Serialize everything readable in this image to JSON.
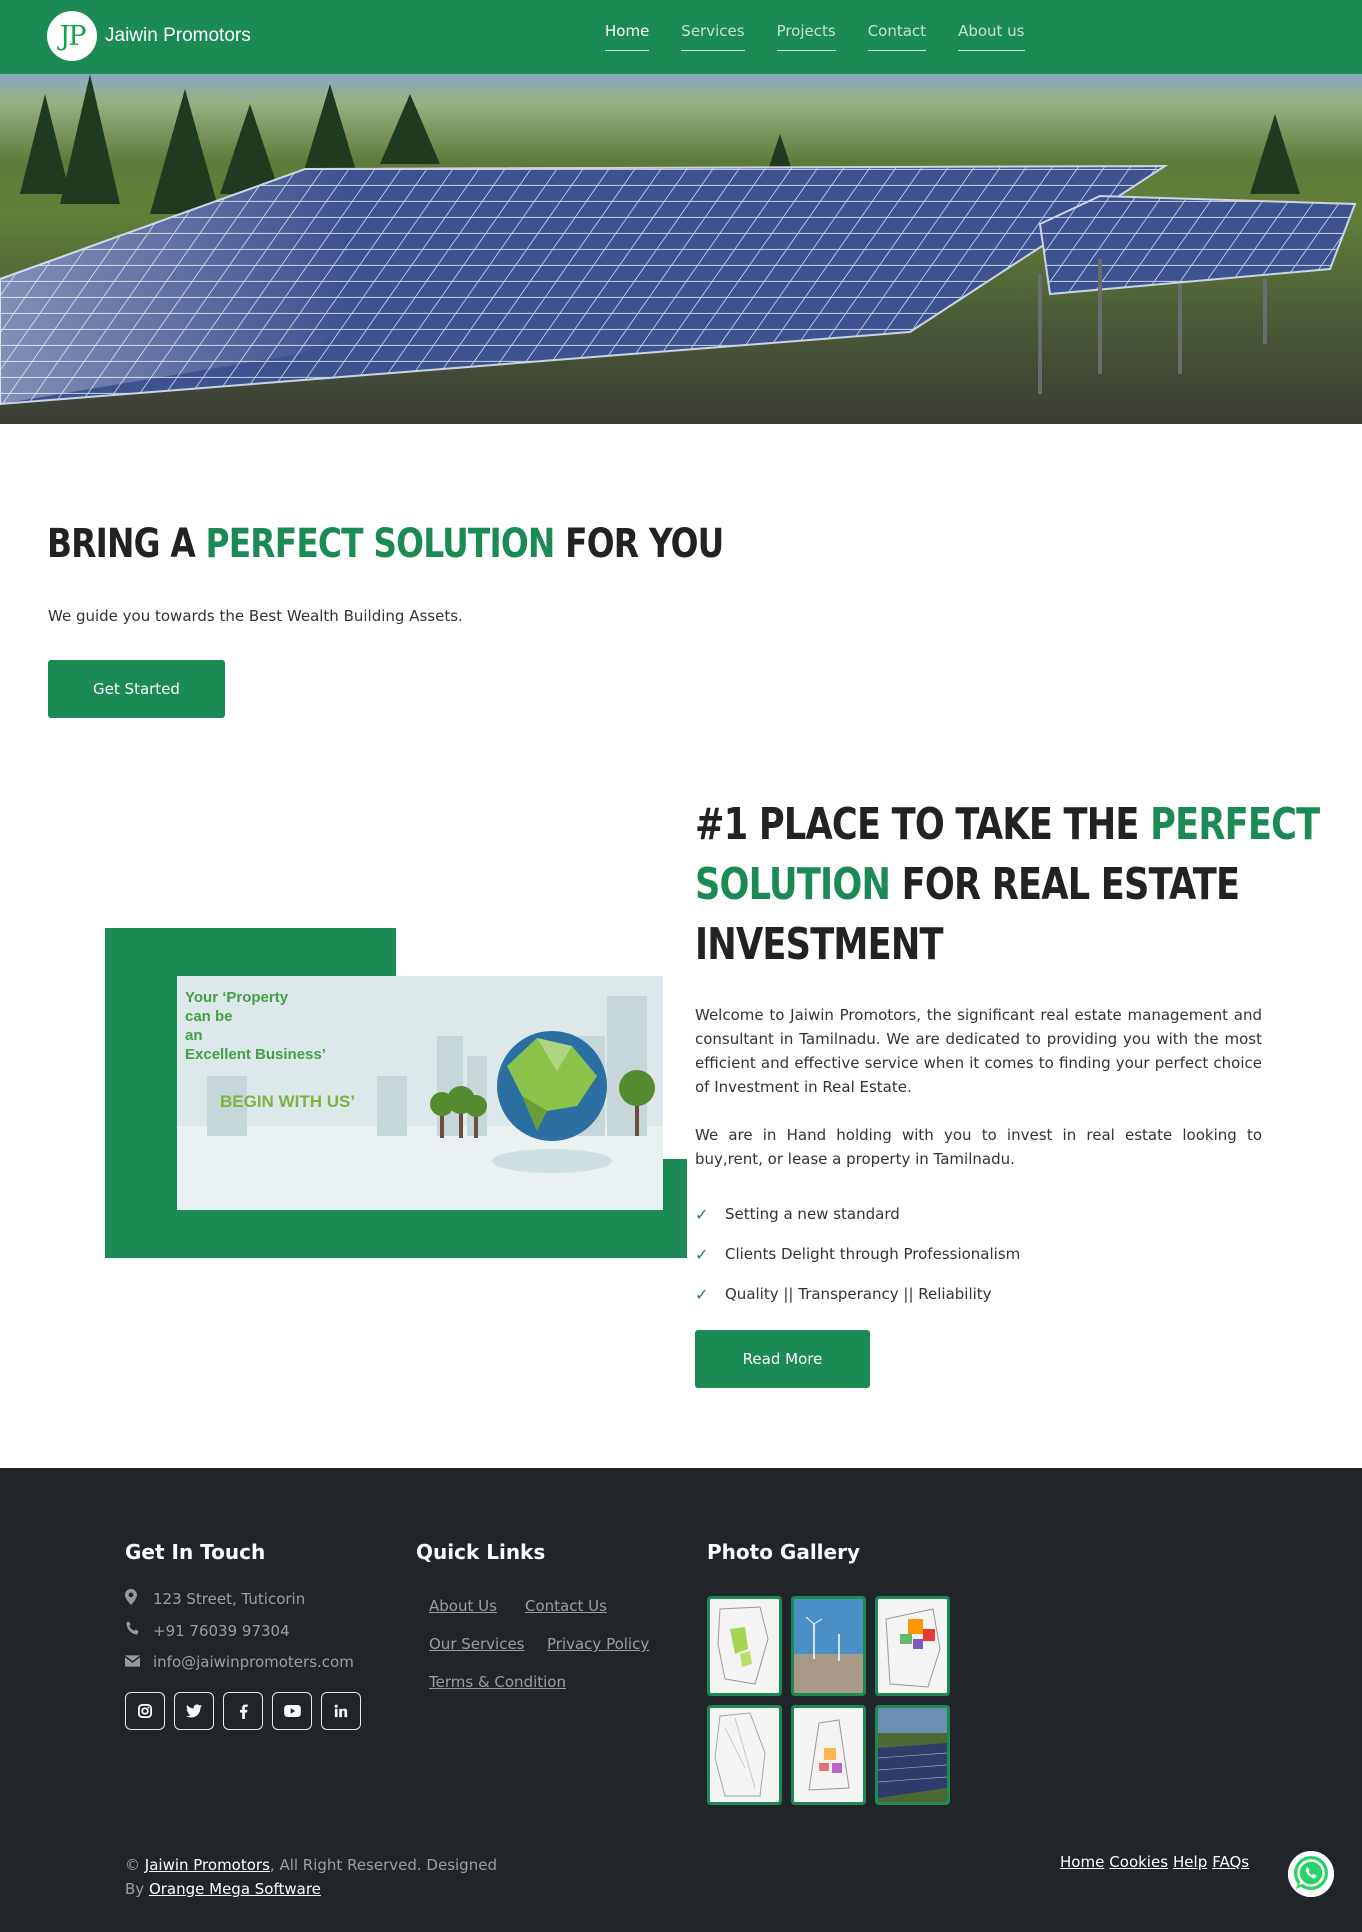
{
  "navbar": {
    "logo_text": "JP",
    "brand": "Jaiwin Promotors",
    "links": [
      "Home",
      "Services",
      "Projects",
      "Contact",
      "About us"
    ]
  },
  "hero_section": {
    "title_pre": "BRING A ",
    "title_highlight": "PERFECT SOLUTION",
    "title_post": " FOR YOU",
    "subtitle": "We guide you towards the Best Wealth Building Assets.",
    "button": "Get Started"
  },
  "promo_image": {
    "line1": "Your ‘Property",
    "line2": "can be",
    "line3": "an",
    "line4": "Excellent Business’",
    "cta": "BEGIN WITH US’"
  },
  "about_section": {
    "title_l1_pre": "#1 PLACE TO TAKE THE ",
    "title_l1_hl": "PERFECT",
    "title_l2_hl": "SOLUTION",
    "title_l2_post": " FOR REAL ESTATE",
    "title_l3": "INVESTMENT",
    "para1": "Welcome to Jaiwin Promotors, the significant real estate management and consultant in Tamilnadu. We are dedicated to providing you with the most efficient and effective service when it comes to finding your perfect choice of Investment in Real Estate.",
    "para2": "We are in Hand holding with you to invest in real estate looking to buy,rent, or lease a property in Tamilnadu.",
    "features": [
      "Setting a new standard",
      "Clients Delight through Professionalism",
      "Quality || Transperancy || Reliability"
    ],
    "button": "Read More"
  },
  "footer": {
    "touch_heading": "Get In Touch",
    "address": "123 Street, Tuticorin",
    "phone": "+91 76039 97304",
    "email": "info@jaiwinpromoters.com",
    "social_icons": [
      "instagram-icon",
      "twitter-icon",
      "facebook-icon",
      "youtube-icon",
      "linkedin-icon"
    ],
    "quick_heading": "Quick Links",
    "quick_links": [
      "About Us",
      "Contact Us",
      "Our Services",
      "Privacy Policy",
      "Terms & Condition"
    ],
    "gallery_heading": "Photo Gallery",
    "copyright_symbol": "©",
    "copyright_brand": "Jaiwin Promotors",
    "copyright_text": ", All Right Reserved. Designed",
    "by": "By ",
    "designer": "Orange Mega Software",
    "bottom_links": [
      "Home",
      "Cookies",
      "Help",
      "FAQs"
    ]
  },
  "colors": {
    "brand_green": "#1b8a55",
    "footer_bg": "#212529"
  }
}
